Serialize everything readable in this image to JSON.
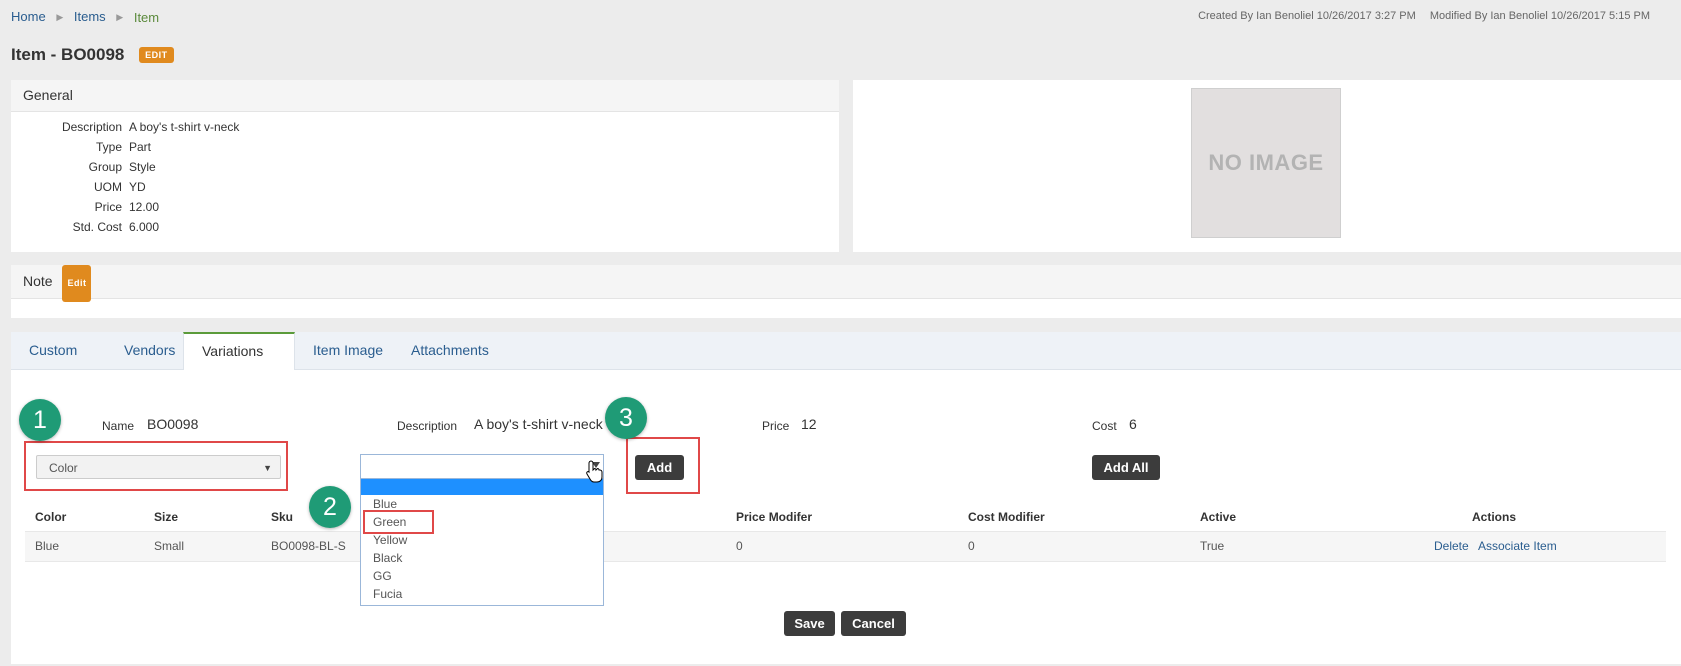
{
  "breadcrumb": {
    "home": "Home",
    "items": "Items",
    "current": "Item"
  },
  "meta": {
    "created": "Created By Ian Benoliel 10/26/2017 3:27 PM",
    "modified": "Modified By Ian Benoliel 10/26/2017 5:15 PM"
  },
  "page": {
    "title": "Item - BO0098",
    "edit_badge": "EDIT"
  },
  "general": {
    "heading": "General",
    "fields": [
      {
        "label": "Description",
        "value": "A boy's t-shirt v-neck"
      },
      {
        "label": "Type",
        "value": "Part"
      },
      {
        "label": "Group",
        "value": "Style"
      },
      {
        "label": "UOM",
        "value": "YD"
      },
      {
        "label": "Price",
        "value": "12.00"
      },
      {
        "label": "Std. Cost",
        "value": "6.000"
      }
    ]
  },
  "image_panel": {
    "placeholder": "NO IMAGE"
  },
  "note": {
    "heading": "Note",
    "edit_badge": "Edit"
  },
  "tabs": [
    "Custom",
    "Vendors",
    "Variations",
    "Item Image",
    "Attachments"
  ],
  "active_tab": "Variations",
  "variation": {
    "name_label": "Name",
    "name_value": "BO0098",
    "description_label": "Description",
    "description_value": "A boy's t-shirt v-neck",
    "price_label": "Price",
    "price_value": "12",
    "cost_label": "Cost",
    "cost_value": "6",
    "attribute_select": "Color",
    "add_button": "Add",
    "add_all_button": "Add All"
  },
  "dropdown": {
    "options": [
      "Blue",
      "Green",
      "Yellow",
      "Black",
      "GG",
      "Fucia"
    ]
  },
  "steps": [
    "1",
    "2",
    "3"
  ],
  "table": {
    "headers": [
      "Color",
      "Size",
      "Sku",
      "Price Modifer",
      "Cost Modifier",
      "Active",
      "Actions"
    ],
    "rows": [
      {
        "color": "Blue",
        "size": "Small",
        "sku": "BO0098-BL-S",
        "price_modifier": "0",
        "cost_modifier": "0",
        "active": "True",
        "delete": "Delete",
        "associate": "Associate Item"
      }
    ]
  },
  "footer": {
    "save": "Save",
    "cancel": "Cancel"
  },
  "colors": {
    "accent_green": "#1f9b76",
    "badge_orange": "#e08a1e",
    "highlight_red": "#e04848"
  }
}
